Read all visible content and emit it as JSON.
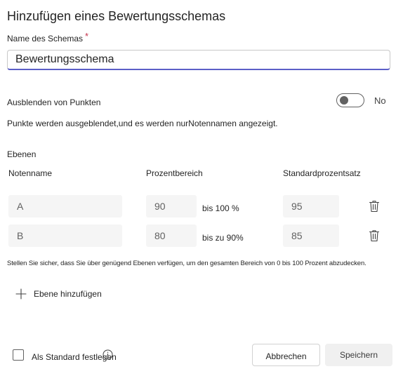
{
  "dialog": {
    "title": "Hinzufügen eines Bewertungsschemas",
    "name_label": "Name des Schemas",
    "required_marker": "*",
    "name_value": "Bewertungsschema",
    "hide_points_label": "Ausblenden von Punkten",
    "hide_points_state": "No",
    "hide_points_description": "Punkte werden ausgeblendet,und es werden nurNotennamen angezeigt.",
    "levels_heading": "Ebenen",
    "columns": {
      "grade_name": "Notenname",
      "percent_range": "Prozentbereich",
      "default_percent": "Standardprozentsatz"
    },
    "levels": [
      {
        "name": "A",
        "range_start": "90",
        "range_suffix": "bis 100 %",
        "default": "95"
      },
      {
        "name": "B",
        "range_start": "80",
        "range_suffix": "bis zu 90%",
        "default": "85"
      }
    ],
    "coverage_warning": "Stellen Sie sicher, dass Sie über genügend Ebenen verfügen, um den gesamten Bereich von 0 bis 100 Prozent abzudecken.",
    "add_level_label": "Ebene hinzufügen",
    "set_default_label": "Als Standard festlegen",
    "cancel_label": "Abbrechen",
    "save_label": "Speichern"
  },
  "icons": {
    "add": "plus-icon",
    "delete": "trash-icon",
    "info": "info-icon",
    "toggle": "toggle-off"
  },
  "colors": {
    "accent": "#5b5fc7",
    "required": "#c4314b",
    "field_bg": "#f5f5f5"
  }
}
